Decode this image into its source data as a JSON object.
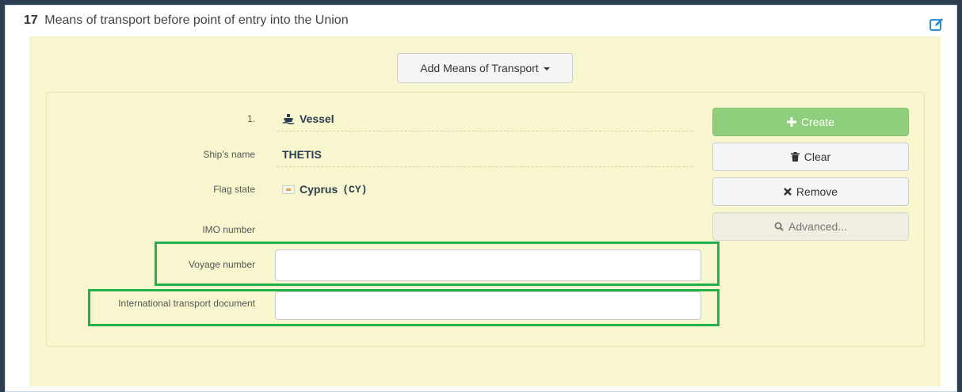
{
  "panel": {
    "number": "17",
    "title": "Means of transport before point of entry into the Union",
    "edit_icon": "edit-icon"
  },
  "add_button": {
    "label": "Add Means of Transport"
  },
  "transport": {
    "index_label": "1.",
    "type_value": "Vessel",
    "ship_name_label": "Ship's name",
    "ship_name_value": "THETIS",
    "flag_state_label": "Flag state",
    "flag_state_value": "Cyprus",
    "flag_state_code": "(CY)",
    "imo_label": "IMO number",
    "imo_value": "",
    "voyage_label": "Voyage number",
    "voyage_value": "",
    "doc_label": "International transport document",
    "doc_value": ""
  },
  "actions": {
    "create": "Create",
    "clear": "Clear",
    "remove": "Remove",
    "advanced": "Advanced..."
  },
  "colors": {
    "highlight": "#22b04b",
    "create_button": "#8fce7c",
    "panel_background": "#f8f6cf"
  }
}
